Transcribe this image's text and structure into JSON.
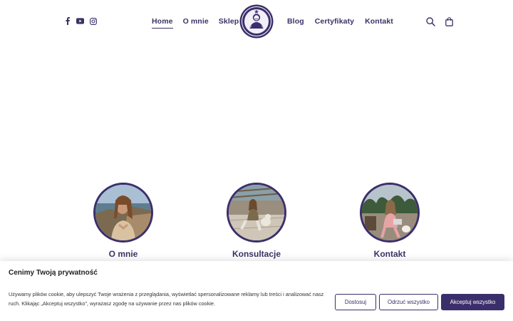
{
  "header": {
    "social": [
      {
        "icon": "facebook-icon"
      },
      {
        "icon": "youtube-icon"
      },
      {
        "icon": "instagram-icon"
      }
    ],
    "nav_left": [
      {
        "label": "Home",
        "active": true
      },
      {
        "label": "O mnie",
        "active": false
      },
      {
        "label": "Sklep",
        "active": false
      }
    ],
    "nav_right": [
      {
        "label": "Blog"
      },
      {
        "label": "Certyfikaty"
      },
      {
        "label": "Kontakt"
      }
    ],
    "icons": [
      "search-icon",
      "shopping-bag-icon"
    ]
  },
  "cards": [
    {
      "title": "O mnie",
      "photo": "portrait-woman-coast"
    },
    {
      "title": "Konsultacje",
      "photo": "woman-sitting-with-dog"
    },
    {
      "title": "Kontakt",
      "photo": "woman-with-laptop-terrace"
    }
  ],
  "cookie": {
    "title": "Cenimy Twoją prywatność",
    "text": "Używamy plików cookie, aby ulepszyć Twoje wrażenia z przeglądania, wyświetlać spersonalizowane reklamy lub treści i analizować nasz ruch. Klikając „Akceptuj wszystko”, wyrażasz zgodę na używanie przez nas plików cookie.",
    "buttons": {
      "customize": "Dostosuj",
      "reject": "Odrzuć wszystko",
      "accept": "Akceptuj wszystko"
    }
  },
  "colors": {
    "brand": "#3b2f6b",
    "text": "#3b3366"
  }
}
